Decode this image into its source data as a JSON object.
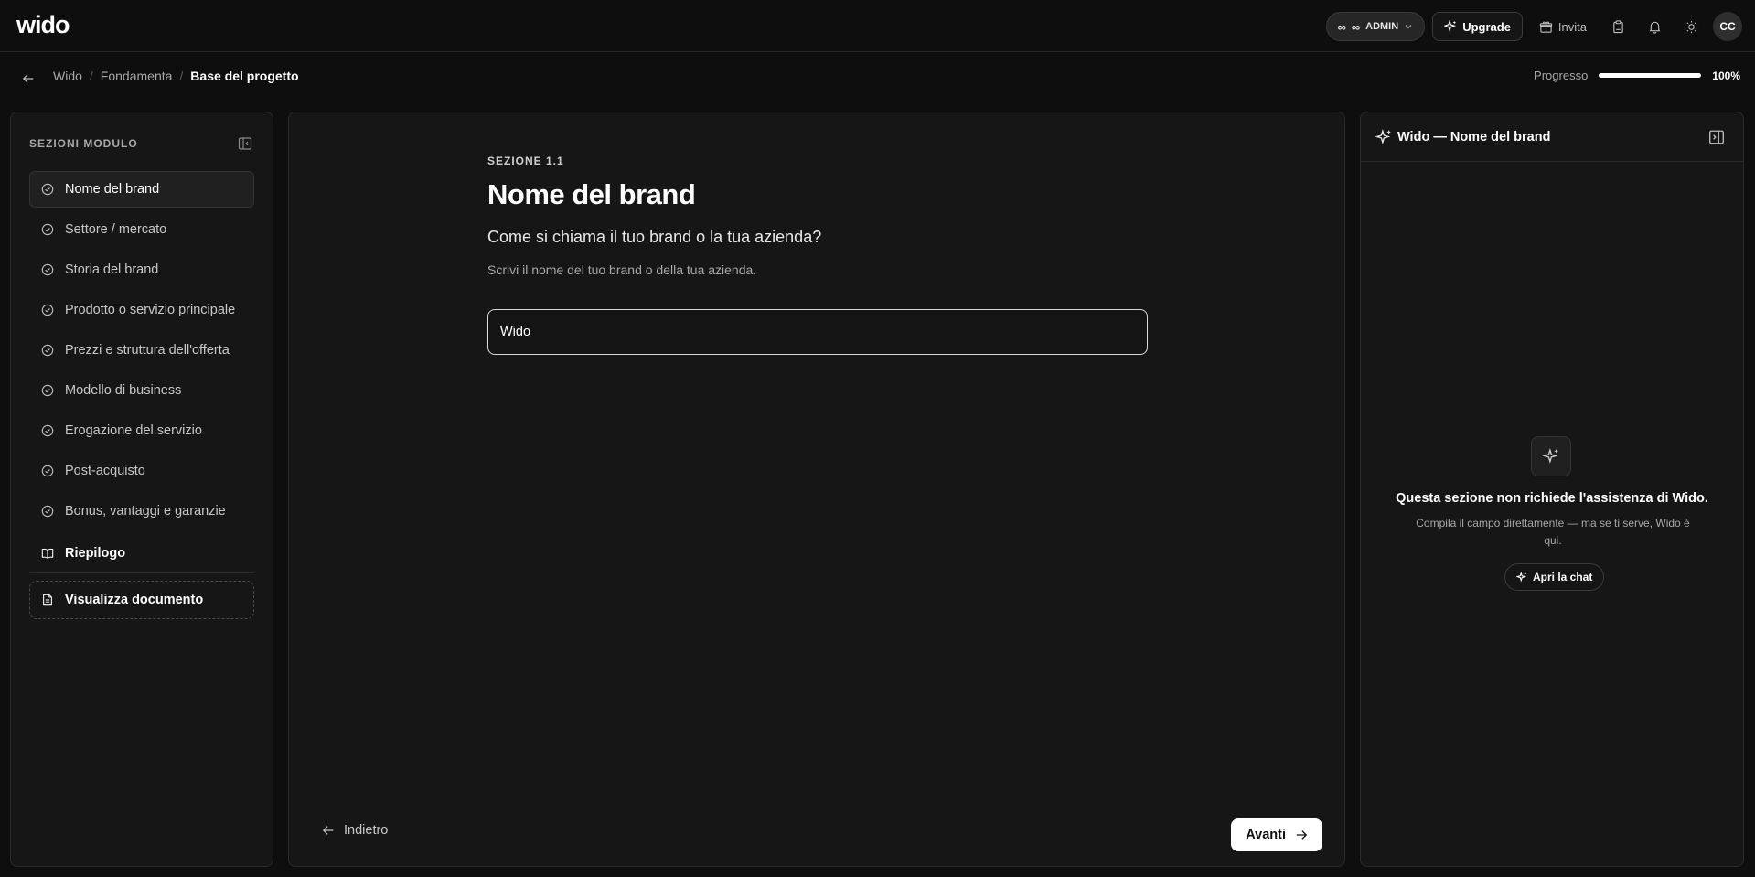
{
  "topbar": {
    "logo": "wido",
    "admin_label": "ADMIN",
    "upgrade_label": "Upgrade",
    "invite_label": "Invita",
    "avatar_initials": "CC"
  },
  "breadcrumb": {
    "items": [
      "Wido",
      "Fondamenta",
      "Base del progetto"
    ]
  },
  "progress": {
    "label": "Progresso",
    "value_text": "100%",
    "fraction": 1.0
  },
  "sidebar": {
    "heading": "SEZIONI MODULO",
    "items": [
      {
        "label": "Nome del brand",
        "active": true
      },
      {
        "label": "Settore / mercato",
        "active": false
      },
      {
        "label": "Storia del brand",
        "active": false
      },
      {
        "label": "Prodotto o servizio principale",
        "active": false
      },
      {
        "label": "Prezzi e struttura dell'offerta",
        "active": false
      },
      {
        "label": "Modello di business",
        "active": false
      },
      {
        "label": "Erogazione del servizio",
        "active": false
      },
      {
        "label": "Post-acquisto",
        "active": false
      },
      {
        "label": "Bonus, vantaggi e garanzie",
        "active": false
      }
    ],
    "summary_label": "Riepilogo",
    "document_label": "Visualizza documento"
  },
  "main": {
    "eyebrow": "SEZIONE 1.1",
    "title": "Nome del brand",
    "question": "Come si chiama il tuo brand o la tua azienda?",
    "help": "Scrivi il nome del tuo brand o della tua azienda.",
    "input_value": "Wido",
    "back_label": "Indietro",
    "next_label": "Avanti"
  },
  "assistant": {
    "title": "Wido — Nome del brand",
    "empty_title": "Questa sezione non richiede l'assistenza di Wido.",
    "empty_sub": "Compila il campo direttamente — ma se ti serve, Wido è qui.",
    "chat_label": "Apri la chat"
  },
  "icons": {
    "admin": "infinity-icon",
    "upgrade": "sparkles-icon",
    "invite": "gift-icon",
    "tasks": "clipboard-icon",
    "notifications": "bell-icon",
    "theme": "sun-icon",
    "section_done": "check-circle-icon",
    "summary": "book-open-icon",
    "document": "file-text-icon",
    "collapse": "panel-left-icon",
    "close": "panel-right-icon"
  }
}
